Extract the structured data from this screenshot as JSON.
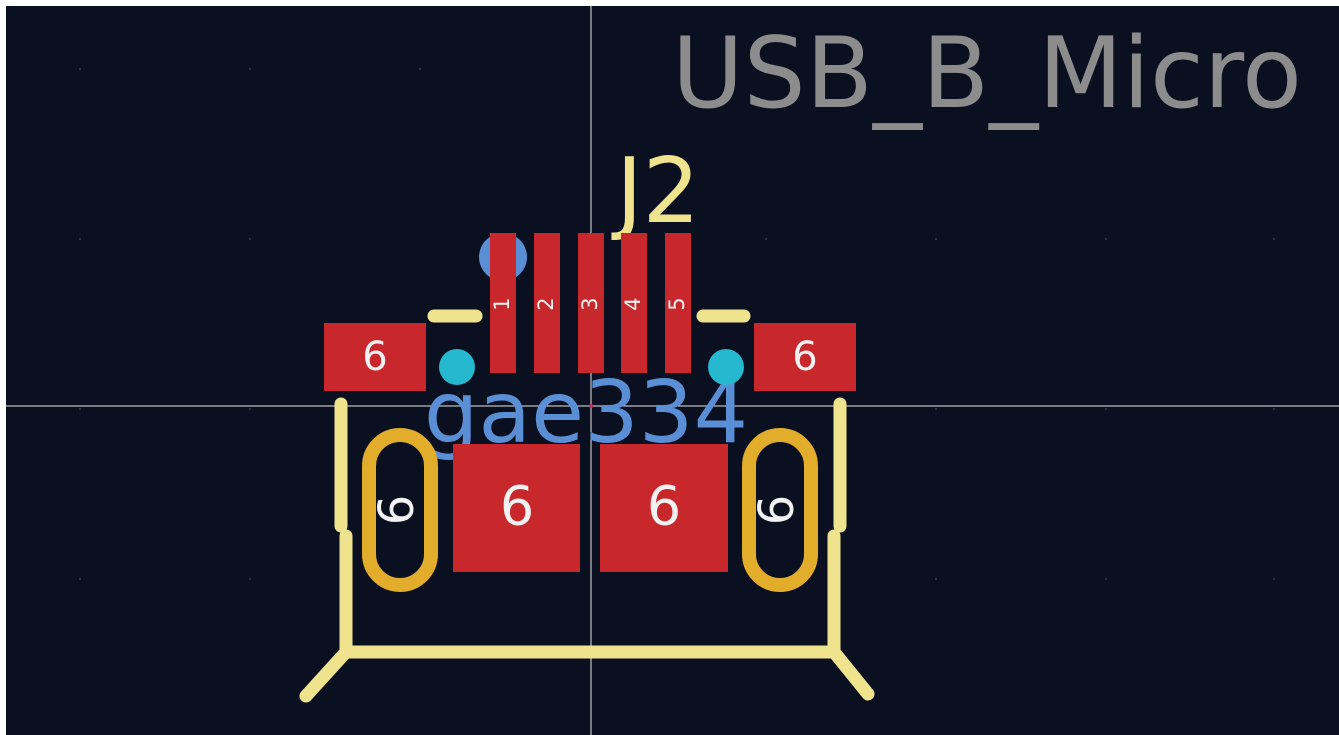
{
  "footprint": {
    "value_text": "USB_B_Micro",
    "reference_text": "J2",
    "user_text": "gae334",
    "pads": [
      {
        "name": "pad-1",
        "label": "1"
      },
      {
        "name": "pad-2",
        "label": "2"
      },
      {
        "name": "pad-3",
        "label": "3"
      },
      {
        "name": "pad-4",
        "label": "4"
      },
      {
        "name": "pad-5",
        "label": "5"
      },
      {
        "name": "pad-6-left-tab",
        "label": "6"
      },
      {
        "name": "pad-6-right-tab",
        "label": "6"
      },
      {
        "name": "pad-6-center-left",
        "label": "6"
      },
      {
        "name": "pad-6-center-right",
        "label": "6"
      },
      {
        "name": "pad-6-left-slot",
        "label": "6"
      },
      {
        "name": "pad-6-right-slot",
        "label": "6"
      }
    ]
  },
  "colors": {
    "background": "#0b1020",
    "pad_red": "#c8282b",
    "pad_gold": "#e1ad2a",
    "silkscreen": "#f0e38e",
    "value_gray": "#8c8c8c",
    "user_blue": "#5a8fd6",
    "via_cyan": "#26b8cf",
    "crosshair": "#e8e8e8",
    "pad_text": "#f2f2f2"
  }
}
